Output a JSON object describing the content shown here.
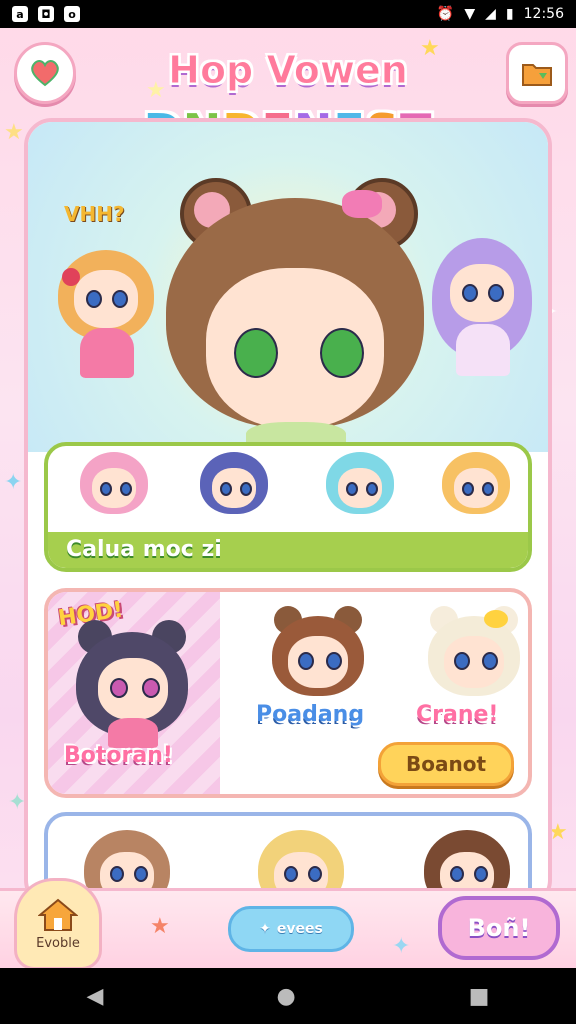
{
  "status_bar": {
    "left_icons": [
      "a",
      "◘",
      "o"
    ],
    "time": "12:56"
  },
  "header": {
    "title_line1": "Hop Vowen",
    "title_line2": "DNDENEST",
    "title_line2_letters": [
      "D",
      "N",
      "D",
      "E",
      "N",
      "E",
      "S",
      "T"
    ],
    "left_button_icon": "heart-icon",
    "right_button_icon": "folder-icon"
  },
  "hero": {
    "speech": "VHH?"
  },
  "strip1": {
    "label": "Calua moc zi"
  },
  "strip2": {
    "badge": "HOD!",
    "left_label": "Botoran!",
    "center_label": "Poadang",
    "right_label": "Crane!",
    "button_label": "Boanot"
  },
  "bottom": {
    "home_label": "Evoble",
    "pill_label": "evees",
    "right_button": "Boñ!"
  },
  "colors": {
    "pink_border": "#f5b8ce",
    "green": "#9bc849",
    "blue": "#9ab5e8",
    "yellow": "#ffd35a"
  }
}
